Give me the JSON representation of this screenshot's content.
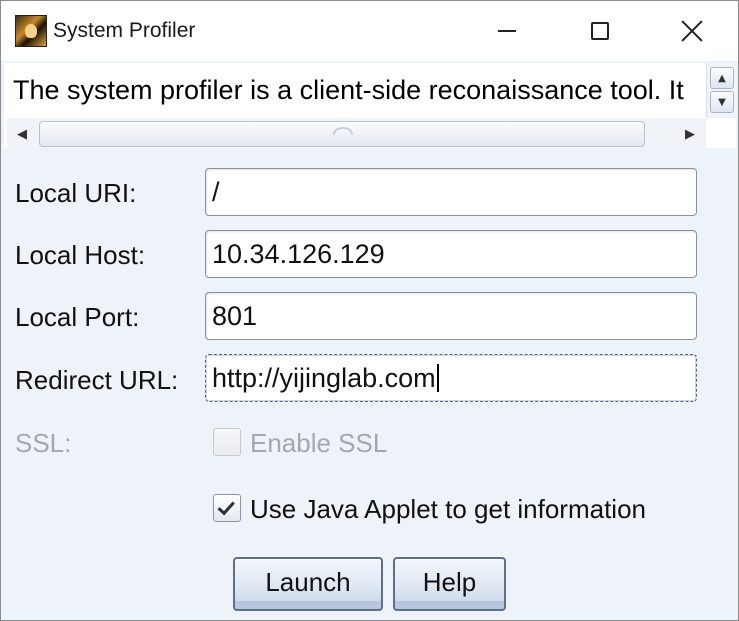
{
  "window": {
    "title": "System Profiler",
    "icon": "app-character-icon",
    "controls": {
      "minimize": "minimize-icon",
      "maximize": "maximize-icon",
      "close": "close-icon"
    }
  },
  "description": {
    "text": "The system profiler is a client-side reconaissance tool. It"
  },
  "form": {
    "local_uri": {
      "label": "Local URI:",
      "value": "/"
    },
    "local_host": {
      "label": "Local Host:",
      "value": "10.34.126.129"
    },
    "local_port": {
      "label": "Local Port:",
      "value": "801"
    },
    "redirect_url": {
      "label": "Redirect URL:",
      "value": "http://yijinglab.com"
    },
    "ssl": {
      "label": "SSL:",
      "checkbox_label": "Enable SSL",
      "checked": false,
      "enabled": false
    },
    "java_applet": {
      "checkbox_label": "Use Java Applet to get information",
      "checked": true
    }
  },
  "buttons": {
    "launch": "Launch",
    "help": "Help"
  }
}
